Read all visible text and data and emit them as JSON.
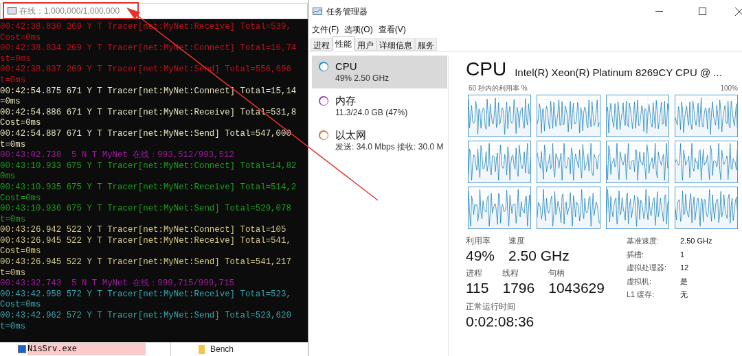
{
  "console": {
    "title": "在线：1,000,000/1,000,000",
    "lines": [
      {
        "text": "00:42:38.830 269 Y T Tracer[net:MyNet:Receive] Total=539,",
        "color": "#c0101c"
      },
      {
        "text": "Cost=0ms",
        "color": "#c0101c"
      },
      {
        "text": "00:42:38.834 269 Y T Tracer[net:MyNet:Connect] Total=16,74",
        "color": "#c0101c"
      },
      {
        "text": "st=0ms",
        "color": "#c0101c"
      },
      {
        "text": "00:42:38.837 269 Y T Tracer[net:MyNet:Send] Total=556,696",
        "color": "#c0101c"
      },
      {
        "text": "t=0ms",
        "color": "#c0101c"
      },
      {
        "text": "00:42:54.875 671 Y T Tracer[net:MyNet:Connect] Total=15,14",
        "color": "#e8e4c0"
      },
      {
        "text": "=0ms",
        "color": "#e8e4c0"
      },
      {
        "text": "00:42:54.886 671 Y T Tracer[net:MyNet:Receive] Total=531,8",
        "color": "#e8e4c0"
      },
      {
        "text": "Cost=0ms",
        "color": "#e8e4c0"
      },
      {
        "text": "00:42:54.887 671 Y T Tracer[net:MyNet:Send] Total=547,000",
        "color": "#e8e4c0"
      },
      {
        "text": "t=0ms",
        "color": "#e8e4c0"
      },
      {
        "text": "00:43:02.738  5 N T MyNet 在线：993,512/993,512",
        "color": "#a01ca0"
      },
      {
        "text": "00:43:10.933 675 Y T Tracer[net:MyNet:Connect] Total=14,82",
        "color": "#1e9e1e"
      },
      {
        "text": "0ms",
        "color": "#1e9e1e"
      },
      {
        "text": "00:43:10.935 675 Y T Tracer[net:MyNet:Receive] Total=514,2",
        "color": "#1e9e1e"
      },
      {
        "text": "Cost=0ms",
        "color": "#1e9e1e"
      },
      {
        "text": "00:43:10.936 675 Y T Tracer[net:MyNet:Send] Total=529,078",
        "color": "#1e9e1e"
      },
      {
        "text": "t=0ms",
        "color": "#1e9e1e"
      },
      {
        "text": "00:43:26.942 522 Y T Tracer[net:MyNet:Connect] Total=105",
        "color": "#d8c98a"
      },
      {
        "text": "00:43:26.945 522 Y T Tracer[net:MyNet:Receive] Total=541,",
        "color": "#d8c98a"
      },
      {
        "text": "Cost=0ms",
        "color": "#d8c98a"
      },
      {
        "text": "00:43:26.945 522 Y T Tracer[net:MyNet:Send] Total=541,217",
        "color": "#d8c98a"
      },
      {
        "text": "t=0ms",
        "color": "#d8c98a"
      },
      {
        "text": "00:43:32.743  5 N T MyNet 在线：999,715/999,715",
        "color": "#a01ca0"
      },
      {
        "text": "00:43:42.958 572 Y T Tracer[net:MyNet:Receive] Total=523,",
        "color": "#3aa6b0"
      },
      {
        "text": "Cost=0ms",
        "color": "#3aa6b0"
      },
      {
        "text": "00:43:42.962 572 Y T Tracer[net:MyNet:Send] Total=523,620",
        "color": "#3aa6b0"
      },
      {
        "text": "t=0ms",
        "color": "#3aa6b0"
      }
    ]
  },
  "background_windows": {
    "file": "NisSrv.exe",
    "folder": "Bench"
  },
  "task_manager": {
    "title": "任务管理器",
    "menu": [
      "文件(F)",
      "选项(O)",
      "查看(V)"
    ],
    "tabs": [
      {
        "label": "进程",
        "selected": false
      },
      {
        "label": "性能",
        "selected": true
      },
      {
        "label": "用户",
        "selected": false
      },
      {
        "label": "详细信息",
        "selected": false
      },
      {
        "label": "服务",
        "selected": false
      }
    ],
    "resources": [
      {
        "name": "CPU",
        "detail": "49%  2.50 GHz",
        "selected": true,
        "color": "#1f8fd0"
      },
      {
        "name": "内存",
        "detail": "11.3/24.0 GB (47%)",
        "selected": false,
        "color": "#a23cc8"
      },
      {
        "name": "以太网",
        "detail": "发送: 34.0 Mbps 接收: 30.0 M",
        "selected": false,
        "color": "#c8783c"
      }
    ],
    "cpu": {
      "heading": "CPU",
      "model": "Intel(R) Xeon(R) Platinum 8269CY CPU @ ...",
      "graph_label": "60 秒内的利用率 %",
      "graph_max": "100%",
      "stats_row_1": [
        {
          "label": "利用率",
          "value": "49%"
        },
        {
          "label": "速度",
          "value": "2.50 GHz"
        }
      ],
      "stats_row_2": [
        {
          "label": "进程",
          "value": "115"
        },
        {
          "label": "线程",
          "value": "1796"
        },
        {
          "label": "句柄",
          "value": "1043629"
        }
      ],
      "uptime": {
        "label": "正常运行时间",
        "value": "0:02:08:36"
      },
      "details": [
        {
          "label": "基准速度:",
          "value": "2.50 GHz"
        },
        {
          "label": "插槽:",
          "value": "1"
        },
        {
          "label": "虚拟处理器:",
          "value": "12"
        },
        {
          "label": "虚拟机:",
          "value": "是"
        },
        {
          "label": "L1 缓存:",
          "value": "无"
        }
      ]
    }
  }
}
